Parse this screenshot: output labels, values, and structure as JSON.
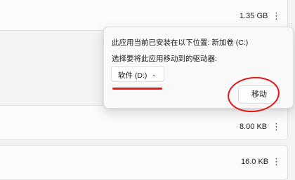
{
  "rows": [
    {
      "size": "1.35 GB",
      "more": "⋮"
    },
    {
      "size": "8.00 KB",
      "more": "⋮"
    },
    {
      "size": "16.0 KB",
      "more": "⋮"
    }
  ],
  "popup": {
    "install_info": "此应用当前已安装在以下位置: 新加卷 (C:)",
    "select_prompt": "选择要将此应用移动到的驱动器:",
    "drive_value": "软件 (D:)",
    "chevron": "⌄",
    "move_label": "移动"
  },
  "annotation_color": "#e01818"
}
